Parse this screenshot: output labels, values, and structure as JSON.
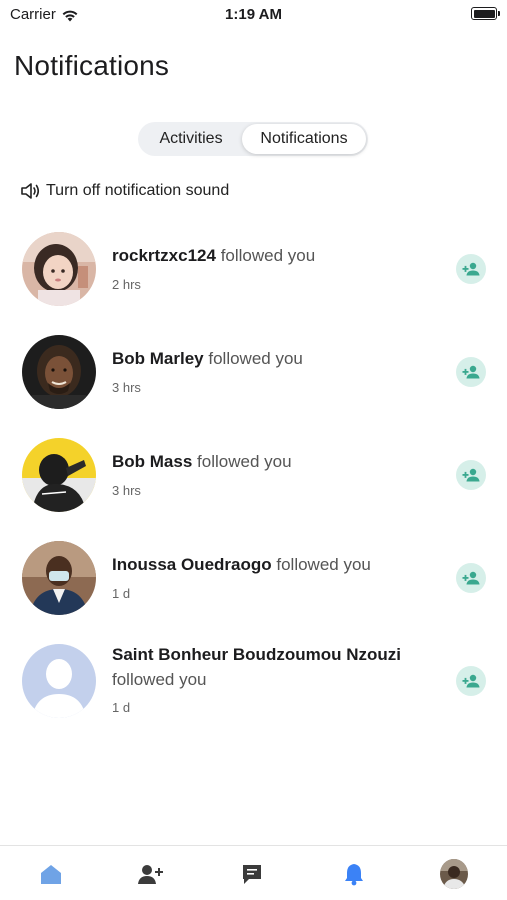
{
  "status_bar": {
    "carrier": "Carrier",
    "time": "1:19 AM"
  },
  "page_title": "Notifications",
  "segmented": {
    "activities_label": "Activities",
    "notifications_label": "Notifications",
    "selected": "Notifications"
  },
  "sound_toggle_label": "Turn off notification sound",
  "notifications": [
    {
      "name": "rockrtzxc124",
      "action": "followed you",
      "time": "2 hrs",
      "avatar": "girl-photo"
    },
    {
      "name": "Bob Marley",
      "action": "followed you",
      "time": "3 hrs",
      "avatar": "man-dreadlocks-photo"
    },
    {
      "name": "Bob Mass",
      "action": "followed you",
      "time": "3 hrs",
      "avatar": "man-yellow-background-photo"
    },
    {
      "name": "Inoussa Ouedraogo",
      "action": "followed you",
      "time": "1 d",
      "avatar": "man-mask-photo"
    },
    {
      "name": "Saint Bonheur Boudzoumou Nzouzi",
      "action": "followed you",
      "time": "1 d",
      "avatar": "default-avatar"
    }
  ],
  "tab_bar": {
    "items": [
      "home-icon",
      "add-user-icon",
      "chat-icon",
      "bell-icon",
      "profile-avatar"
    ],
    "active": "home-icon"
  },
  "colors": {
    "accent_green": "#3aa88f",
    "accent_green_bg": "#d6efe9",
    "home_icon": "#6fa3e6",
    "bell_icon": "#3b82f6",
    "default_avatar": "#c3d0ec"
  }
}
